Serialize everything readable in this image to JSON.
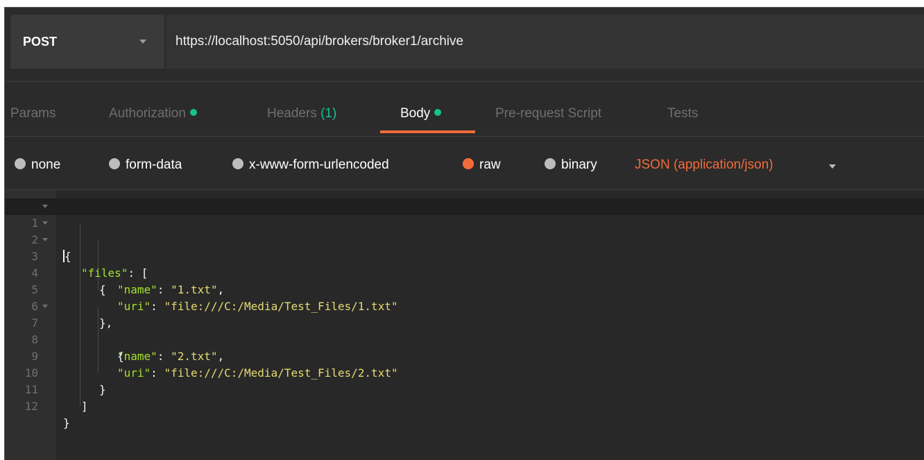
{
  "request": {
    "method": "POST",
    "url": "https://localhost:5050/api/brokers/broker1/archive"
  },
  "tabs": [
    {
      "label": "Params",
      "indicator": "",
      "active": false
    },
    {
      "label": "Authorization",
      "indicator": "dot",
      "active": false
    },
    {
      "label": "Headers",
      "count": "(1)",
      "active": false
    },
    {
      "label": "Body",
      "indicator": "dot",
      "active": true
    },
    {
      "label": "Pre-request Script",
      "indicator": "",
      "active": false
    },
    {
      "label": "Tests",
      "indicator": "",
      "active": false
    }
  ],
  "body_types": [
    {
      "label": "none",
      "selected": false
    },
    {
      "label": "form-data",
      "selected": false
    },
    {
      "label": "x-www-form-urlencoded",
      "selected": false
    },
    {
      "label": "raw",
      "selected": true
    },
    {
      "label": "binary",
      "selected": false
    }
  ],
  "content_type": "JSON (application/json)",
  "editor": {
    "lines": [
      {
        "n": "1",
        "fold": true
      },
      {
        "n": "2",
        "fold": true
      },
      {
        "n": "3",
        "fold": true
      },
      {
        "n": "4",
        "fold": false
      },
      {
        "n": "5",
        "fold": false
      },
      {
        "n": "6",
        "fold": false
      },
      {
        "n": "7",
        "fold": true
      },
      {
        "n": "8",
        "fold": false
      },
      {
        "n": "9",
        "fold": false
      },
      {
        "n": "10",
        "fold": false
      },
      {
        "n": "11",
        "fold": false
      },
      {
        "n": "12",
        "fold": false
      }
    ],
    "tokens": {
      "l1": "{",
      "l2_key": "\"files\"",
      "l2_rest": ": [",
      "l3": "{",
      "l4_key": "\"name\"",
      "l4_sep": ": ",
      "l4_val": "\"1.txt\"",
      "l4_end": ",",
      "l5_key": "\"uri\"",
      "l5_sep": ": ",
      "l5_val": "\"file:///C:/Media/Test_Files/1.txt\"",
      "l6": "},",
      "l7": "{",
      "l8_key": "\"name\"",
      "l8_sep": ": ",
      "l8_val": "\"2.txt\"",
      "l8_end": ",",
      "l9_key": "\"uri\"",
      "l9_sep": ": ",
      "l9_val": "\"file:///C:/Media/Test_Files/2.txt\"",
      "l10": "}",
      "l11": "]",
      "l12": "}"
    }
  },
  "colors": {
    "accent": "#f26b3a",
    "status_dot": "#16c28f",
    "json_key": "#a6e22e",
    "json_string": "#e6db74"
  }
}
